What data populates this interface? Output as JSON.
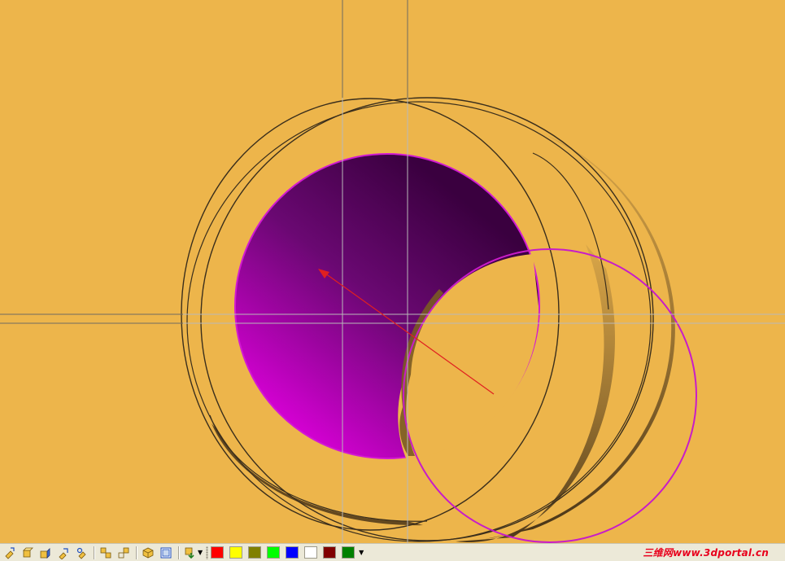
{
  "viewport": {
    "background_color": "#EDB54B",
    "hole_gradient_colors": [
      "#3A003F",
      "#DA00D8"
    ],
    "hole_outline_color": "#D21AD2",
    "sketch_circle_color": "#C81CC8",
    "wall_shade_colors": [
      "#5A4220",
      "#D8A548"
    ],
    "edge_color": "#3A2E1C",
    "crosshair_color": "#B9B9B9",
    "arrow_color": "#E02020"
  },
  "toolbar": {
    "view_buttons": [
      {
        "name": "view-isometric-icon"
      },
      {
        "name": "view-front-icon"
      },
      {
        "name": "view-top-icon"
      },
      {
        "name": "view-right-icon"
      },
      {
        "name": "view-left-icon"
      },
      {
        "name": "view-bottom-icon"
      },
      {
        "name": "view-back-icon"
      }
    ],
    "render_buttons": [
      {
        "name": "shaded-view-icon"
      },
      {
        "name": "wireframe-view-icon"
      }
    ],
    "insert_button": {
      "name": "insert-dropdown-icon"
    },
    "colors": [
      "#FF0000",
      "#FFFF00",
      "#808000",
      "#00FF00",
      "#0000FF",
      "#FFFFFF",
      "#800000",
      "#008000"
    ]
  },
  "watermark": {
    "text": "三维网www.3dportal.cn"
  }
}
